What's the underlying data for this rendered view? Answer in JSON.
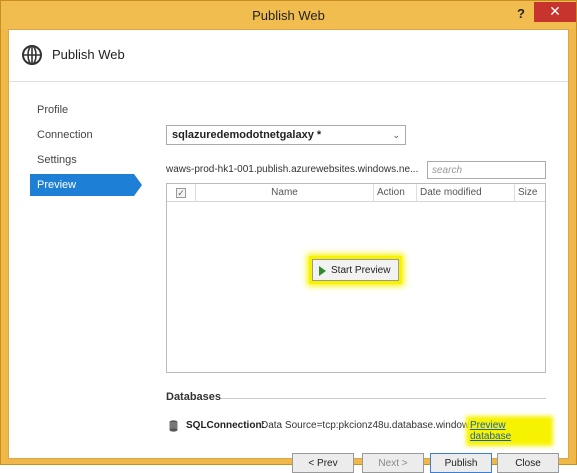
{
  "window": {
    "title": "Publish Web",
    "help_label": "?",
    "close_label": "✕"
  },
  "header": {
    "title": "Publish Web",
    "icon": "globe-icon"
  },
  "nav": {
    "items": [
      {
        "label": "Profile",
        "active": false
      },
      {
        "label": "Connection",
        "active": false
      },
      {
        "label": "Settings",
        "active": false
      },
      {
        "label": "Preview",
        "active": true
      }
    ]
  },
  "profile": {
    "selected": "sqlazuredemodotnetgalaxy *",
    "server_url": "waws-prod-hk1-001.publish.azurewebsites.windows.ne..."
  },
  "search": {
    "placeholder": "search",
    "value": ""
  },
  "file_table": {
    "columns": [
      "Name",
      "Action",
      "Date modified",
      "Size"
    ],
    "rows": [],
    "start_preview_label": "Start Preview"
  },
  "databases": {
    "heading": "Databases",
    "items": [
      {
        "name": "SQLConnection:",
        "source": "Data Source=tcp:pkcionz48u.database.window...",
        "link_label": "Preview database"
      }
    ]
  },
  "buttons": {
    "prev": "< Prev",
    "next": "Next >",
    "publish": "Publish",
    "close": "Close"
  },
  "colors": {
    "chrome": "#f1bd4f",
    "accent": "#1e7fd6",
    "highlight": "#f7f300",
    "close_red": "#c7332d"
  }
}
